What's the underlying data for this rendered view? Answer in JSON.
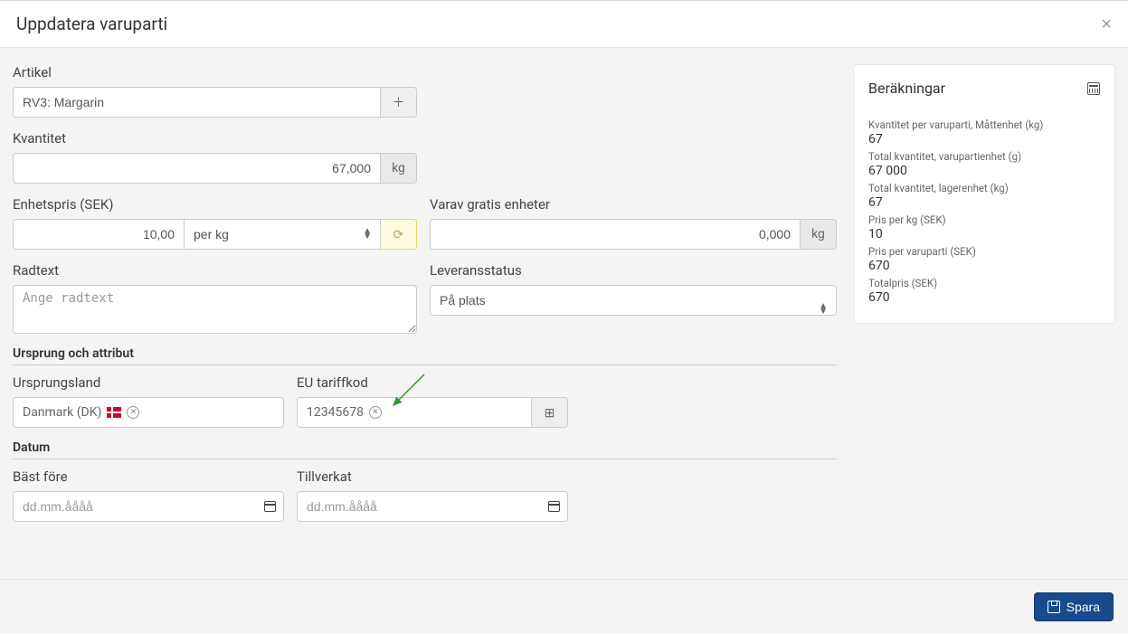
{
  "modal": {
    "title": "Uppdatera varuparti"
  },
  "form": {
    "article": {
      "label": "Artikel",
      "value": "RV3: Margarin"
    },
    "quantity": {
      "label": "Kvantitet",
      "value": "67,000",
      "unit": "kg"
    },
    "unitprice": {
      "label": "Enhetspris (SEK)",
      "value": "10,00",
      "per_option": "per kg"
    },
    "freeunits": {
      "label": "Varav gratis enheter",
      "value": "0,000",
      "unit": "kg"
    },
    "rowtext": {
      "label": "Radtext",
      "placeholder": "Ange radtext"
    },
    "delivery": {
      "label": "Leveransstatus",
      "value": "På plats"
    },
    "origin_section": "Ursprung och attribut",
    "origin_country": {
      "label": "Ursprungsland",
      "value": "Danmark (DK)"
    },
    "tariff": {
      "label": "EU tariffkod",
      "value": "12345678"
    },
    "date_section": "Datum",
    "bestbefore": {
      "label": "Bäst före",
      "placeholder": "dd.mm.åååå"
    },
    "manufactured": {
      "label": "Tillverkat",
      "placeholder": "dd.mm.åååå"
    }
  },
  "calc": {
    "title": "Beräkningar",
    "rows": [
      {
        "label": "Kvantitet per varuparti, Måttenhet (kg)",
        "value": "67"
      },
      {
        "label": "Total kvantitet, varupartienhet (g)",
        "value": "67 000"
      },
      {
        "label": "Total kvantitet, lagerenhet (kg)",
        "value": "67"
      },
      {
        "label": "Pris per kg (SEK)",
        "value": "10"
      },
      {
        "label": "Pris per varuparti (SEK)",
        "value": "670"
      },
      {
        "label": "Totalpris (SEK)",
        "value": "670"
      }
    ]
  },
  "footer": {
    "save": "Spara"
  }
}
